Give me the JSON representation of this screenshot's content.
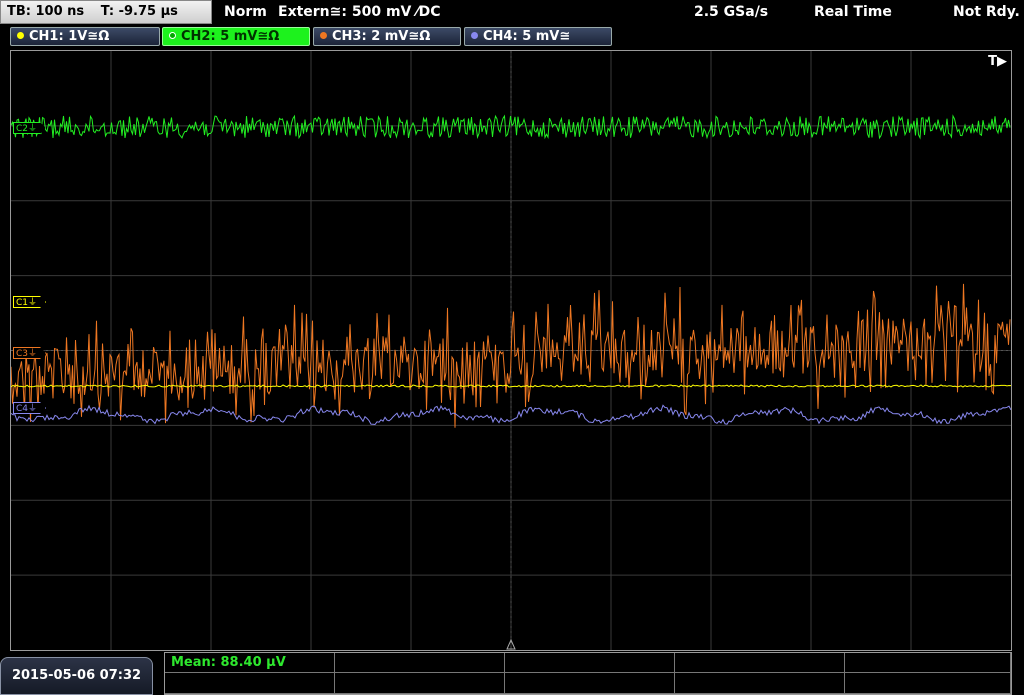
{
  "status": {
    "timebase": "TB: 100 ns",
    "trigger_time": "T: -9.75 µs",
    "mode": "Norm",
    "trigger_source": "Extern≅: 500 mV ⁄DC",
    "sample_rate": "2.5 GSa/s",
    "acquisition": "Real Time",
    "ready_state": "Not Rdy."
  },
  "channels": [
    {
      "label": "CH1: 1V≅Ω",
      "color": "#ffff00",
      "marker": "C1⏚",
      "active": false
    },
    {
      "label": "CH2: 5 mV≅Ω",
      "color": "#22ee22",
      "marker": "C2⏚",
      "active": true
    },
    {
      "label": "CH3: 2 mV≅Ω",
      "color": "#ee7722",
      "marker": "C3⏚",
      "active": false
    },
    {
      "label": "CH4: 5 mV≅",
      "color": "#8888ee",
      "marker": "C4⏚",
      "active": false
    }
  ],
  "trigger_marker": "T▶",
  "datetime": "2015-05-06 07:32",
  "measurement": {
    "mean": "Mean: 88.40 µV"
  }
}
